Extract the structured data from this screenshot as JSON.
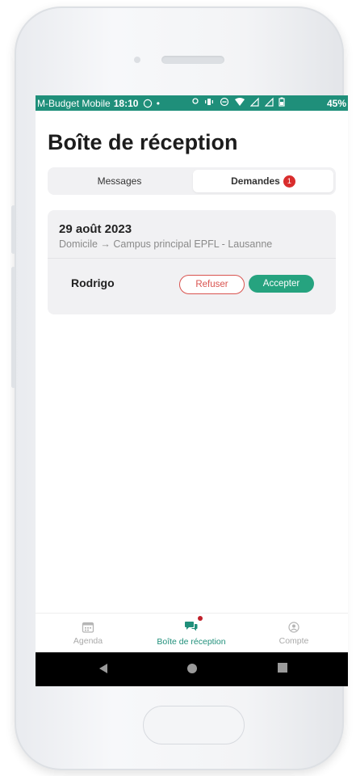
{
  "status_bar": {
    "carrier": "M-Budget Mobile",
    "time": "18:10",
    "battery": "45%",
    "color": "#1f8f7a"
  },
  "page": {
    "title": "Boîte de réception"
  },
  "segments": {
    "messages_label": "Messages",
    "demandes_label": "Demandes",
    "demandes_badge": "1"
  },
  "request": {
    "date": "29 août 2023",
    "route": "Domicile → Campus principal EPFL - Lausanne",
    "name": "Rodrigo",
    "refuse_label": "Refuser",
    "accept_label": "Accepter"
  },
  "bottom_nav": {
    "items": [
      {
        "label": "Agenda",
        "icon": "calendar-icon"
      },
      {
        "label": "Boîte de réception",
        "icon": "chat-bubbles-icon",
        "active": true
      },
      {
        "label": "Compte",
        "icon": "user-circle-icon"
      }
    ]
  },
  "android_nav": {
    "back_icon": "triangle-back-icon",
    "home_icon": "circle-home-icon",
    "recents_icon": "square-recents-icon"
  },
  "colors": {
    "accent": "#1f8f7a",
    "accept": "#26a37f",
    "refuse": "#d9534f",
    "badge": "#d92d2d"
  }
}
